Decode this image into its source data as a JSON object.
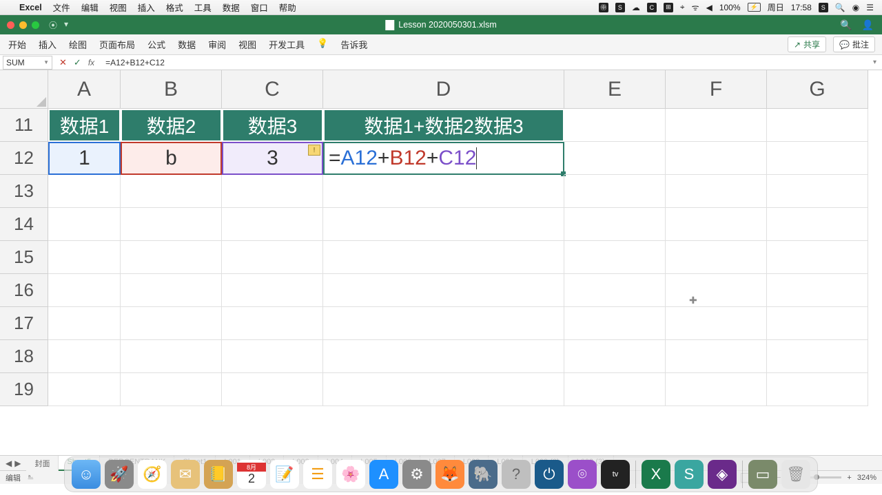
{
  "menubar": {
    "app": "Excel",
    "items": [
      "文件",
      "编辑",
      "视图",
      "插入",
      "格式",
      "工具",
      "数据",
      "窗口",
      "帮助"
    ],
    "battery": "100%",
    "day": "周日",
    "time": "17:58"
  },
  "window": {
    "title": "Lesson 2020050301.xlsm"
  },
  "ribbon": {
    "tabs": [
      "开始",
      "插入",
      "绘图",
      "页面布局",
      "公式",
      "数据",
      "审阅",
      "视图",
      "开发工具"
    ],
    "tellme": "告诉我",
    "share": "共享",
    "comments": "批注"
  },
  "formulabar": {
    "namebox": "SUM",
    "formula": "=A12+B12+C12"
  },
  "columns": [
    "A",
    "B",
    "C",
    "D",
    "E",
    "F",
    "G"
  ],
  "rows": [
    "11",
    "12",
    "13",
    "14",
    "15",
    "16",
    "17",
    "18",
    "19"
  ],
  "headers": {
    "A": "数据1",
    "B": "数据2",
    "C": "数据3",
    "D": "数据1+数据2数据3"
  },
  "data_row": {
    "A": "1",
    "B": "b",
    "C": "3"
  },
  "formula_cell": {
    "refA": "A12",
    "refB": "B12",
    "refC": "C12"
  },
  "sheet_tabs": [
    "封面",
    "Sheet5",
    "PERCENTRANK",
    "Sheet1",
    "L001",
    "L002",
    "L003",
    "L004",
    "L005",
    "L006",
    "L007",
    "L008",
    "L009",
    "L009 (2)",
    "L009 (3)"
  ],
  "active_sheet": "Sheet5",
  "status": {
    "mode": "编辑",
    "zoom": "324%"
  },
  "chart_data": {
    "type": "table",
    "columns": [
      "数据1",
      "数据2",
      "数据3",
      "数据1+数据2数据3"
    ],
    "rows": [
      {
        "数据1": "1",
        "数据2": "b",
        "数据3": "3",
        "数据1+数据2数据3": "=A12+B12+C12"
      }
    ]
  }
}
